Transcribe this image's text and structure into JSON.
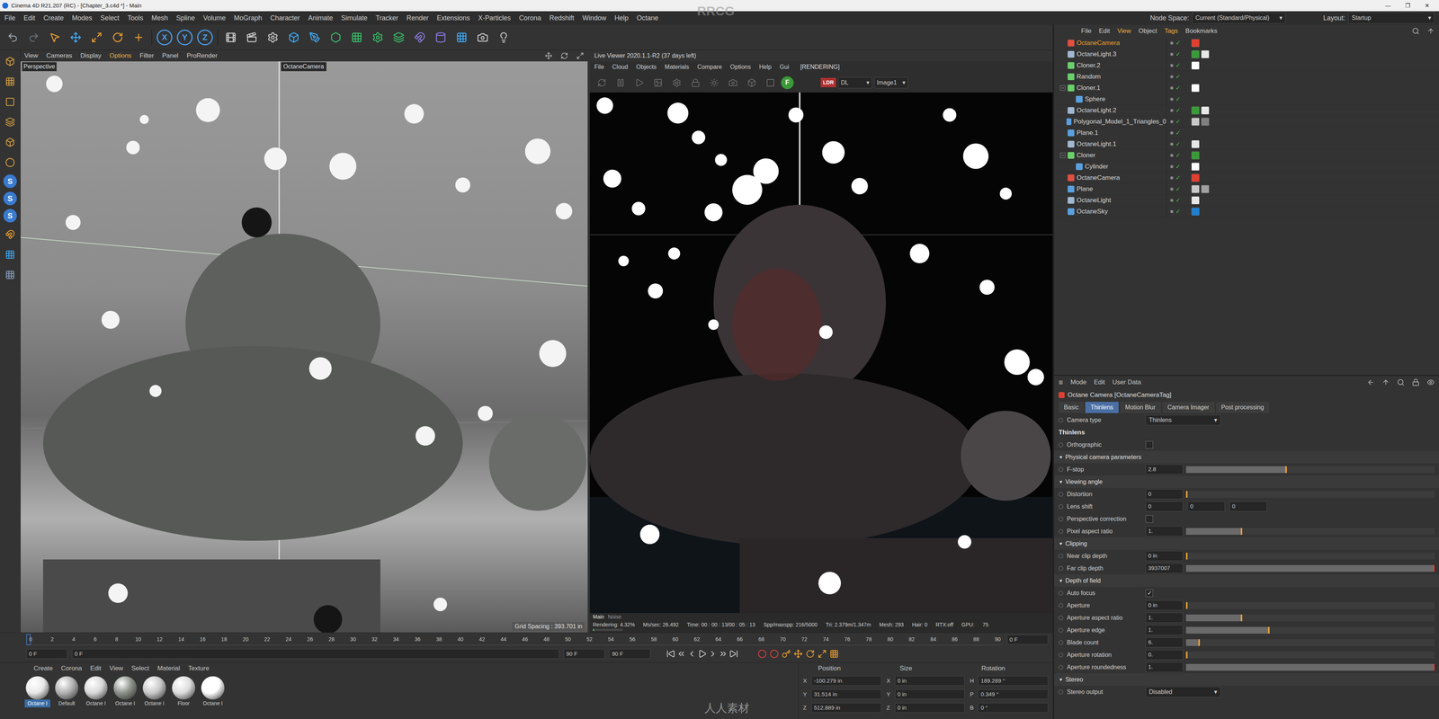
{
  "window": {
    "title": "Cinema 4D R21.207 (RC) - [Chapter_3.c4d *] - Main",
    "controls": [
      "—",
      "❐",
      "✕"
    ]
  },
  "watermarks": [
    "RRCG",
    "人人素材"
  ],
  "menu": [
    "File",
    "Edit",
    "Create",
    "Modes",
    "Select",
    "Tools",
    "Mesh",
    "Spline",
    "Volume",
    "MoGraph",
    "Character",
    "Animate",
    "Simulate",
    "Tracker",
    "Render",
    "Extensions",
    "X-Particles",
    "Corona",
    "Redshift",
    "Window",
    "Help",
    "Octane"
  ],
  "node_space": {
    "label": "Node Space:",
    "value": "Current (Standard/Physical)"
  },
  "layout": {
    "label": "Layout:",
    "value": "Startup"
  },
  "toolbar": {
    "axis": [
      {
        "label": "X",
        "on": true
      },
      {
        "label": "Y",
        "on": true
      },
      {
        "label": "Z",
        "on": true
      }
    ]
  },
  "left_tools": [
    "S",
    "S",
    "S"
  ],
  "viewport": {
    "menu": [
      {
        "label": "View",
        "selected": false
      },
      {
        "label": "Cameras",
        "selected": false
      },
      {
        "label": "Display",
        "selected": false
      },
      {
        "label": "Options",
        "selected": true
      },
      {
        "label": "Filter",
        "selected": false
      },
      {
        "label": "Panel",
        "selected": false
      },
      {
        "label": "ProRender",
        "selected": false
      }
    ],
    "label": "Perspective",
    "camera": "OctaneCamera",
    "grid": "Grid Spacing : 393.701 in"
  },
  "live_viewer": {
    "title": "Live Viewer 2020.1.1-R2 (37 days left)",
    "menu": [
      "File",
      "Cloud",
      "Objects",
      "Materials",
      "Compare",
      "Options",
      "Help",
      "Gui"
    ],
    "state": "[RENDERING]",
    "focus_badge": "F",
    "badge": "LDR",
    "mode": "DL",
    "image": "Image1",
    "tabs": [
      {
        "label": "Main",
        "selected": true
      },
      {
        "label": "Noise",
        "selected": false
      }
    ],
    "progress": 0.0432,
    "stats": [
      "Rendering: 4.32%",
      "Ms/sec: 26.492",
      "Time: 00 : 00 : 13/00 : 05 : 13",
      "Spp/maxspp: 216/5000",
      "Tri: 2.379m/1.347m",
      "Mesh: 293",
      "Hair: 0",
      "RTX:off",
      "GPU:",
      "75"
    ]
  },
  "timeline": {
    "ticks": [
      "0",
      "2",
      "4",
      "6",
      "8",
      "10",
      "12",
      "14",
      "16",
      "18",
      "20",
      "22",
      "24",
      "26",
      "28",
      "30",
      "32",
      "34",
      "36",
      "38",
      "40",
      "42",
      "44",
      "46",
      "48",
      "50",
      "52",
      "54",
      "56",
      "58",
      "60",
      "62",
      "64",
      "66",
      "68",
      "70",
      "72",
      "74",
      "76",
      "78",
      "80",
      "82",
      "84",
      "86",
      "88",
      "90"
    ],
    "playhead": 0,
    "frame_display": "0 F",
    "start": "0 F",
    "current": "0 F",
    "end": "90 F",
    "end_max": "90 F"
  },
  "materials": {
    "menu": [
      "Create",
      "Corona",
      "Edit",
      "View",
      "Select",
      "Material",
      "Texture"
    ],
    "items": [
      {
        "name": "Octane I",
        "color": "#e8e8e8",
        "selected": true
      },
      {
        "name": "Default",
        "color": "#b0b0b0",
        "selected": false
      },
      {
        "name": "Octane I",
        "color": "#d8d8d8",
        "selected": false
      },
      {
        "name": "Octane I",
        "color": "#8a9088",
        "selected": false
      },
      {
        "name": "Octane I",
        "color": "#c8c8c8",
        "selected": false
      },
      {
        "name": "Floor",
        "color": "#dcdcdc",
        "selected": false
      },
      {
        "name": "Octane I",
        "color": "#ffffff",
        "selected": false
      }
    ]
  },
  "coordinates": {
    "headers": [
      "Position",
      "Size",
      "Rotation"
    ],
    "rows": [
      {
        "axis": "X",
        "position": "-100.279 in",
        "size_axis": "X",
        "size": "0 in",
        "rot_axis": "H",
        "rotation": "189.289 °"
      },
      {
        "axis": "Y",
        "position": "31.514 in",
        "size_axis": "Y",
        "size": "0 in",
        "rot_axis": "P",
        "rotation": "0.349 °"
      },
      {
        "axis": "Z",
        "position": "512.889 in",
        "size_axis": "Z",
        "size": "0 in",
        "rot_axis": "B",
        "rotation": "0 °"
      }
    ]
  },
  "objects": {
    "menu": [
      {
        "label": "File",
        "selected": false
      },
      {
        "label": "Edit",
        "selected": false
      },
      {
        "label": "View",
        "selected": true
      },
      {
        "label": "Object",
        "selected": false
      },
      {
        "label": "Tags",
        "selected": true
      },
      {
        "label": "Bookmarks",
        "selected": false
      }
    ],
    "items": [
      {
        "name": "OctaneCamera",
        "depth": 0,
        "selected": true,
        "expandable": false,
        "expanded": false,
        "enabled": true,
        "color": "#e05040",
        "tag_colors": [
          "#e04030"
        ]
      },
      {
        "name": "OctaneLight.3",
        "depth": 0,
        "selected": false,
        "expandable": false,
        "expanded": false,
        "enabled": true,
        "color": "#a0b8d0",
        "tag_colors": [
          "#3a9a3a",
          "#e8e8e8"
        ]
      },
      {
        "name": "Cloner.2",
        "depth": 0,
        "selected": false,
        "expandable": false,
        "expanded": false,
        "enabled": true,
        "color": "#6ad06a",
        "tag_colors": [
          "#ffffff"
        ]
      },
      {
        "name": "Random",
        "depth": 0,
        "selected": false,
        "expandable": false,
        "expanded": false,
        "enabled": true,
        "color": "#6ad06a",
        "tag_colors": []
      },
      {
        "name": "Cloner.1",
        "depth": 0,
        "selected": false,
        "expandable": true,
        "expanded": true,
        "enabled": true,
        "color": "#6ad06a",
        "tag_colors": [
          "#ffffff"
        ]
      },
      {
        "name": "Sphere",
        "depth": 1,
        "selected": false,
        "expandable": false,
        "expanded": false,
        "enabled": true,
        "color": "#5aa0e0",
        "tag_colors": []
      },
      {
        "name": "OctaneLight.2",
        "depth": 0,
        "selected": false,
        "expandable": false,
        "expanded": false,
        "enabled": true,
        "color": "#a0b8d0",
        "tag_colors": [
          "#3a9a3a",
          "#e8e8e8"
        ]
      },
      {
        "name": "Polygonal_Model_1_Triangles_0",
        "depth": 0,
        "selected": false,
        "expandable": false,
        "expanded": false,
        "enabled": true,
        "color": "#5aa0e0",
        "tag_colors": [
          "#c8c8c8",
          "#808080"
        ]
      },
      {
        "name": "Plane.1",
        "depth": 0,
        "selected": false,
        "expandable": false,
        "expanded": false,
        "enabled": true,
        "color": "#5aa0e0",
        "tag_colors": []
      },
      {
        "name": "OctaneLight.1",
        "depth": 0,
        "selected": false,
        "expandable": false,
        "expanded": false,
        "enabled": true,
        "color": "#a0b8d0",
        "tag_colors": [
          "#e8e8e8"
        ]
      },
      {
        "name": "Cloner",
        "depth": 0,
        "selected": false,
        "expandable": true,
        "expanded": true,
        "enabled": true,
        "color": "#6ad06a",
        "tag_colors": [
          "#3a9a3a"
        ]
      },
      {
        "name": "Cylinder",
        "depth": 1,
        "selected": false,
        "expandable": false,
        "expanded": false,
        "enabled": true,
        "color": "#5aa0e0",
        "tag_colors": [
          "#ffffff"
        ]
      },
      {
        "name": "OctaneCamera",
        "depth": 0,
        "selected": false,
        "expandable": false,
        "expanded": false,
        "enabled": true,
        "color": "#e05040",
        "tag_colors": [
          "#e04030"
        ]
      },
      {
        "name": "Plane",
        "depth": 0,
        "selected": false,
        "expandable": false,
        "expanded": false,
        "enabled": true,
        "color": "#5aa0e0",
        "tag_colors": [
          "#c8c8c8",
          "#a0a0a0"
        ]
      },
      {
        "name": "OctaneLight",
        "depth": 0,
        "selected": false,
        "expandable": false,
        "expanded": false,
        "enabled": true,
        "color": "#a0b8d0",
        "tag_colors": [
          "#e8e8e8"
        ]
      },
      {
        "name": "OctaneSky",
        "depth": 0,
        "selected": false,
        "expandable": false,
        "expanded": false,
        "enabled": true,
        "color": "#5aa0e0",
        "tag_colors": [
          "#2080d0"
        ]
      }
    ]
  },
  "attributes": {
    "menu": [
      "Mode",
      "Edit",
      "User Data"
    ],
    "title": "Octane Camera [OctaneCameraTag]",
    "tabs": [
      {
        "label": "Basic",
        "selected": false
      },
      {
        "label": "Thinlens",
        "selected": true
      },
      {
        "label": "Motion Blur",
        "selected": false
      },
      {
        "label": "Camera Imager",
        "selected": false
      },
      {
        "label": "Post processing",
        "selected": false
      }
    ],
    "rows": [
      {
        "kind": "dropdown",
        "label": "Camera type",
        "value": "Thinlens"
      },
      {
        "kind": "heading",
        "label": "Thinlens"
      },
      {
        "kind": "checkbox",
        "label": "Orthographic",
        "checked": false
      },
      {
        "kind": "section",
        "label": "Physical camera parameters",
        "expanded": true
      },
      {
        "kind": "slider",
        "label": "F-stop",
        "value": "2.8",
        "level": 0.4
      },
      {
        "kind": "section",
        "label": "Viewing angle",
        "expanded": true
      },
      {
        "kind": "slider",
        "label": "Distortion",
        "value": "0",
        "level": 0
      },
      {
        "kind": "multi",
        "label": "Lens shift",
        "values": [
          "0",
          "0",
          "0"
        ]
      },
      {
        "kind": "checkbox",
        "label": "Perspective correction",
        "checked": false
      },
      {
        "kind": "slider",
        "label": "Pixel aspect ratio",
        "value": "1.",
        "level": 0.22
      },
      {
        "kind": "section",
        "label": "Clipping",
        "expanded": true
      },
      {
        "kind": "slider",
        "label": "Near clip depth",
        "value": "0 in",
        "level": 0
      },
      {
        "kind": "slider",
        "label": "Far clip depth",
        "value": "3937007",
        "level": 1
      },
      {
        "kind": "section",
        "label": "Depth of field",
        "expanded": true
      },
      {
        "kind": "checkbox",
        "label": "Auto focus",
        "checked": true
      },
      {
        "kind": "slider",
        "label": "Aperture",
        "value": "0 in",
        "level": 0
      },
      {
        "kind": "slider",
        "label": "Aperture aspect ratio",
        "value": "1.",
        "level": 0.22
      },
      {
        "kind": "slider",
        "label": "Aperture edge",
        "value": "1.",
        "level": 0.33
      },
      {
        "kind": "slider",
        "label": "Blade count",
        "value": "6.",
        "level": 0.05
      },
      {
        "kind": "slider",
        "label": "Aperture rotation",
        "value": "0.",
        "level": 0
      },
      {
        "kind": "slider",
        "label": "Aperture roundedness",
        "value": "1.",
        "level": 1
      },
      {
        "kind": "section",
        "label": "Stereo",
        "expanded": true
      },
      {
        "kind": "dropdown",
        "label": "Stereo output",
        "value": "Disabled"
      }
    ]
  }
}
